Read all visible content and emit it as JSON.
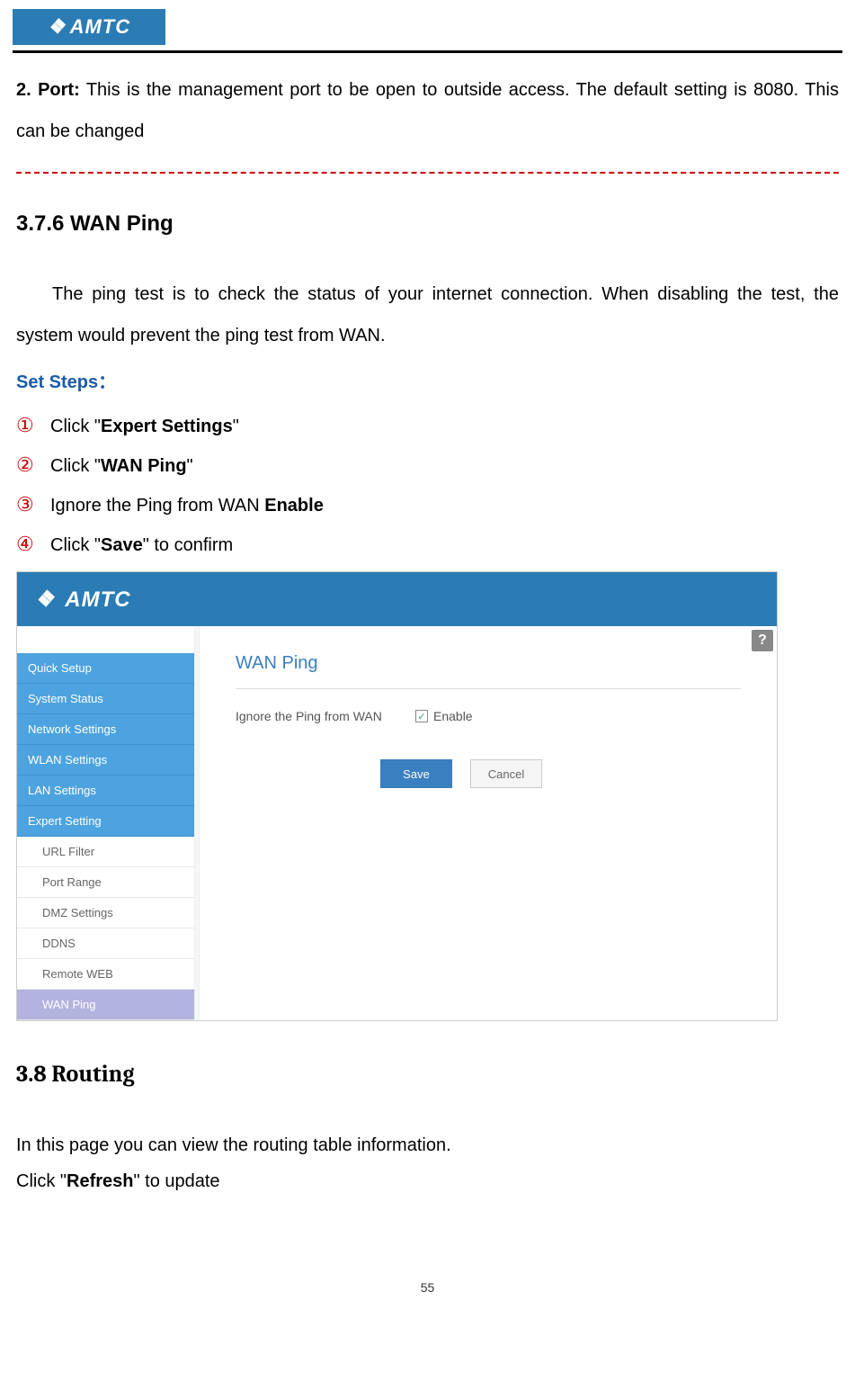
{
  "header": {
    "logo_text": "AMTC"
  },
  "port_section": {
    "label": "2. Port:",
    "text_part1": " This is the management port to be open to outside access. The default setting is 8080. This can be changed"
  },
  "wan_ping": {
    "heading": "3.7.6 WAN Ping",
    "intro": "The ping test is to check the status of your internet connection. When disabling the test, the system would prevent the ping test from WAN.",
    "set_steps_label": "Set Steps：",
    "steps": [
      {
        "num": "①",
        "pre": "Click \"",
        "bold": "Expert Settings",
        "post": "\""
      },
      {
        "num": "②",
        "pre": "Click \"",
        "bold": "WAN Ping",
        "post": "\""
      },
      {
        "num": "③",
        "pre": "Ignore the Ping from WAN ",
        "bold": "Enable",
        "post": ""
      },
      {
        "num": "④",
        "pre": "Click \"",
        "bold": "Save",
        "post": "\" to confirm"
      }
    ]
  },
  "screenshot": {
    "logo": "AMTC",
    "sidebar": {
      "quick_setup": "Quick Setup",
      "system_status": "System Status",
      "network_settings": "Network Settings",
      "wlan_settings": "WLAN Settings",
      "lan_settings": "LAN Settings",
      "expert_setting": "Expert Setting",
      "url_filter": "URL Filter",
      "port_range": "Port Range",
      "dmz_settings": "DMZ Settings",
      "ddns": "DDNS",
      "remote_web": "Remote WEB",
      "wan_ping": "WAN Ping"
    },
    "panel": {
      "title": "WAN Ping",
      "row_label": "Ignore the Ping from WAN",
      "enable_label": "Enable",
      "checkmark": "✓",
      "save": "Save",
      "cancel": "Cancel",
      "help": "?"
    }
  },
  "routing": {
    "heading": "3.8 Routing",
    "line1": "In this page you can view the routing table information.",
    "line2_pre": "Click \"",
    "line2_bold": "Refresh",
    "line2_post": "\" to update"
  },
  "page_number": "55"
}
